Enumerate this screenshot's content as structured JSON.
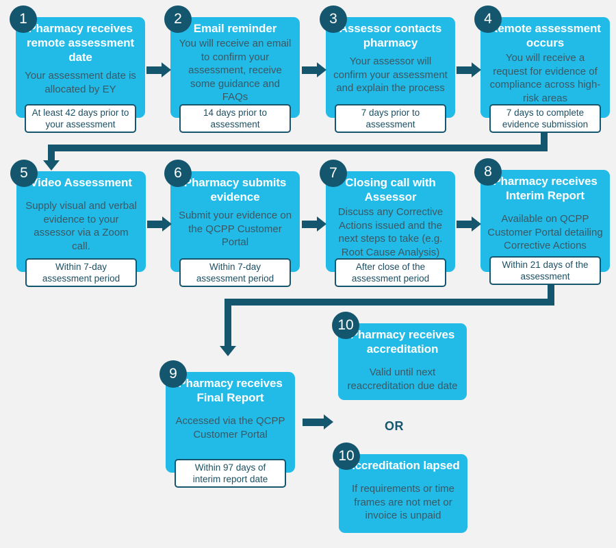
{
  "background_color": "#f2f2f2",
  "accent_color": "#22bbe8",
  "dark_color": "#14566e",
  "body_text_color": "#3b5762",
  "steps": [
    {
      "number": "1",
      "title": "Pharmacy receives remote assessment date",
      "body": "Your assessment date is allocated by EY",
      "timeframe": "At least 42 days prior to your assessment"
    },
    {
      "number": "2",
      "title": "Email reminder",
      "body": "You will receive an email to confirm your assessment, receive some guidance and FAQs",
      "timeframe": "14 days prior to assessment"
    },
    {
      "number": "3",
      "title": "Assessor contacts pharmacy",
      "body": "Your assessor will confirm your assessment and explain the process",
      "timeframe": "7 days prior to assessment"
    },
    {
      "number": "4",
      "title": "Remote assessment occurs",
      "body": "You will receive a request for evidence of compliance across high-risk areas",
      "timeframe": "7 days to complete evidence submission"
    },
    {
      "number": "5",
      "title": "Video Assessment",
      "body": "Supply visual and verbal evidence to your assessor via a Zoom call.",
      "timeframe": "Within 7-day assessment period"
    },
    {
      "number": "6",
      "title": "Pharmacy submits evidence",
      "body": "Submit your evidence on the QCPP Customer Portal",
      "timeframe": "Within 7-day assessment period"
    },
    {
      "number": "7",
      "title": "Closing call with Assessor",
      "body": "Discuss any Corrective Actions issued and the next steps to take (e.g. Root Cause Analysis)",
      "timeframe": "After close of the assessment period"
    },
    {
      "number": "8",
      "title": "Pharmacy receives Interim Report",
      "body": "Available on QCPP Customer Portal detailing Corrective Actions",
      "timeframe": "Within 21 days of the assessment"
    },
    {
      "number": "9",
      "title": "Pharmacy receives Final Report",
      "body": "Accessed via the QCPP Customer Portal",
      "timeframe": "Within 97 days of interim report date"
    },
    {
      "number": "10",
      "title": "Pharmacy receives accreditation",
      "body": "Valid until next reaccreditation due date",
      "timeframe": ""
    },
    {
      "number": "10",
      "title": "Accreditation lapsed",
      "body": "If requirements or time frames are not met or invoice is unpaid",
      "timeframe": ""
    }
  ],
  "or_label": "OR"
}
